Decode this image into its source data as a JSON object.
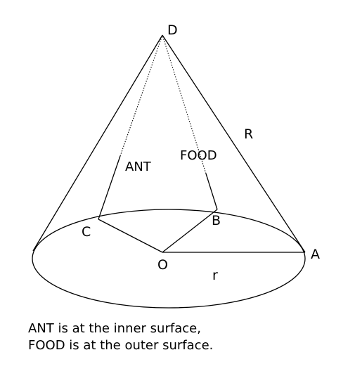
{
  "labels": {
    "apex": "D",
    "rim_right": "A",
    "point_b": "B",
    "point_c": "C",
    "center": "O",
    "slant_height": "R",
    "radius": "r",
    "ant": "ANT",
    "food": "FOOD"
  },
  "caption": {
    "line1": "ANT is at the inner surface,",
    "line2": "FOOD is at the outer surface."
  },
  "colors": {
    "stroke": "#000000",
    "background": "#ffffff"
  }
}
